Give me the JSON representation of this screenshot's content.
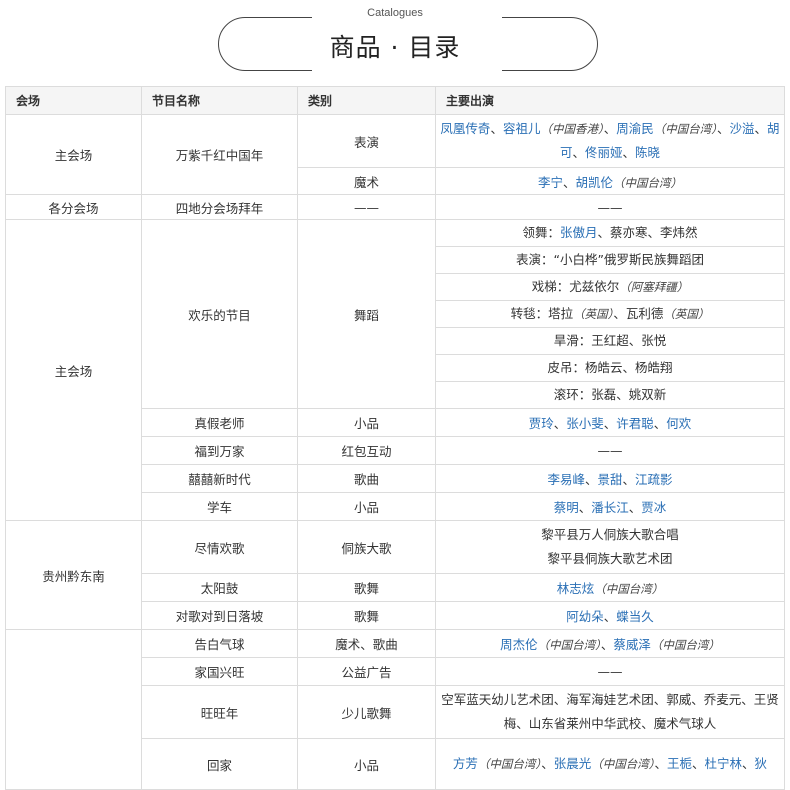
{
  "header": {
    "caption_en": "Catalogues",
    "title_cn": "商品 · 目录"
  },
  "columns": {
    "venue": "会场",
    "program": "节目名称",
    "category": "类别",
    "performers": "主要出演"
  },
  "cells": {
    "r1_venue": "主会场",
    "r1_program": "万紫千红中国年",
    "r1_cat_a": "表演",
    "r1_perf_a": {
      "p1": "凤凰传奇",
      "p2": "容祖儿",
      "p2_note": "（中国香港）",
      "p3": "周渝民",
      "p3_note": "（中国台湾）",
      "p4": "沙溢",
      "p5": "胡可",
      "p6": "佟丽娅",
      "p7": "陈晓"
    },
    "r1_cat_b": "魔术",
    "r1_perf_b": {
      "p1": "李宁",
      "p2": "胡凯伦",
      "p2_note": "（中国台湾）"
    },
    "r2_venue": "各分会场",
    "r2_program": "四地分会场拜年",
    "r2_cat": "——",
    "r2_perf": "——",
    "r3_venue": "主会场",
    "r3_program": "欢乐的节目",
    "r3_cat": "舞蹈",
    "r3_lines": {
      "l1_label": "领舞：",
      "l1_link": "张傲月",
      "l1_rest": "、蔡亦寒、李炜然",
      "l2": "表演：“小白桦”俄罗斯民族舞蹈团",
      "l3_text": "戏梯：尤兹依尔",
      "l3_note": "（阿塞拜疆）",
      "l4_text": "转毯：塔拉",
      "l4_note1": "（英国）",
      "l4_mid": "、瓦利德",
      "l4_note2": "（英国）",
      "l5": "旱滑：王红超、张悦",
      "l6": "皮吊：杨皓云、杨皓翔",
      "l7": "滚环：张磊、姚双新"
    },
    "r4_program": "真假老师",
    "r4_cat": "小品",
    "r4_perf": {
      "p1": "贾玲",
      "p2": "张小斐",
      "p3": "许君聪",
      "p4": "何欢"
    },
    "r5_program": "福到万家",
    "r5_cat": "红包互动",
    "r5_perf": "——",
    "r6_program": "囍囍新时代",
    "r6_cat": "歌曲",
    "r6_perf": {
      "p1": "李易峰",
      "p2": "景甜",
      "p3": "江疏影"
    },
    "r7_program": "学车",
    "r7_cat": "小品",
    "r7_perf": {
      "p1": "蔡明",
      "p2": "潘长江",
      "p3": "贾冰"
    },
    "r8_venue": "贵州黔东南",
    "r8_program": "尽情欢歌",
    "r8_cat": "侗族大歌",
    "r8_perf_l1": "黎平县万人侗族大歌合唱",
    "r8_perf_l2": "黎平县侗族大歌艺术团",
    "r9_program": "太阳鼓",
    "r9_cat": "歌舞",
    "r9_perf": {
      "p1": "林志炫",
      "p1_note": "（中国台湾）"
    },
    "r10_program": "对歌对到日落坡",
    "r10_cat": "歌舞",
    "r10_perf": {
      "p1": "阿幼朵",
      "p2": "蝶当久"
    },
    "r11_program": "告白气球",
    "r11_cat": "魔术、歌曲",
    "r11_perf": {
      "p1": "周杰伦",
      "p1_note": "（中国台湾）",
      "p2": "蔡威泽",
      "p2_note": "（中国台湾）"
    },
    "r12_program": "家国兴旺",
    "r12_cat": "公益广告",
    "r12_perf": "——",
    "r13_program": "旺旺年",
    "r13_cat": "少儿歌舞",
    "r13_perf": "空军蓝天幼儿艺术团、海军海娃艺术团、郭威、乔麦元、王贤梅、山东省莱州中华武校、魔术气球人",
    "r14_program": "回家",
    "r14_cat": "小品",
    "r14_perf": {
      "p1": "方芳",
      "p1_note": "（中国台湾）",
      "p2": "张晨光",
      "p2_note": "（中国台湾）",
      "p3": "王栀",
      "p4": "杜宁林",
      "p5": "狄"
    }
  }
}
